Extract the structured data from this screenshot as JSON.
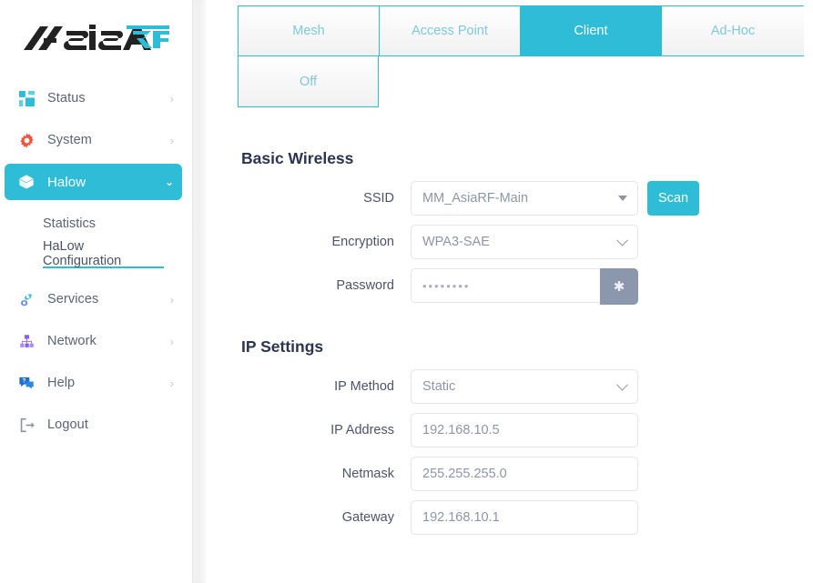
{
  "brand": {
    "name_dark": "Asia",
    "name_accent": "RF",
    "accent_color": "#2ebcd6",
    "dark_color": "#222222"
  },
  "sidebar": {
    "items": [
      {
        "label": "Status",
        "icon": "grid-icon",
        "caret": "›",
        "active": false
      },
      {
        "label": "System",
        "icon": "gear-icon",
        "caret": "›",
        "active": false
      },
      {
        "label": "Halow",
        "icon": "cube-icon",
        "caret": "⌄",
        "active": true
      },
      {
        "label": "Services",
        "icon": "gears-icon",
        "caret": "›",
        "active": false
      },
      {
        "label": "Network",
        "icon": "sitemap-icon",
        "caret": "›",
        "active": false
      },
      {
        "label": "Help",
        "icon": "help-chat-icon",
        "caret": "›",
        "active": false
      },
      {
        "label": "Logout",
        "icon": "logout-icon",
        "caret": "",
        "active": false
      }
    ],
    "subitems": [
      {
        "label": "Statistics",
        "current": false
      },
      {
        "label": "HaLow Configuration",
        "current": true
      }
    ]
  },
  "main": {
    "tabs": [
      {
        "label": "Mesh",
        "active": false
      },
      {
        "label": "Access Point",
        "active": false
      },
      {
        "label": "Client",
        "active": true
      },
      {
        "label": "Ad-Hoc",
        "active": false
      },
      {
        "label": "Off",
        "active": false
      }
    ],
    "basic_wireless": {
      "title": "Basic Wireless",
      "ssid": {
        "label": "SSID",
        "value": "MM_AsiaRF-Main",
        "options": [
          "MM_AsiaRF-Main"
        ],
        "scan_label": "Scan"
      },
      "encryption": {
        "label": "Encryption",
        "value": "WPA3-SAE",
        "options": [
          "WPA3-SAE"
        ]
      },
      "password": {
        "label": "Password",
        "value": "••••••••",
        "toggle_glyph": "✱"
      }
    },
    "ip_settings": {
      "title": "IP Settings",
      "ip_method": {
        "label": "IP Method",
        "value": "Static",
        "options": [
          "Static"
        ]
      },
      "ip_address": {
        "label": "IP Address",
        "value": "192.168.10.5"
      },
      "netmask": {
        "label": "Netmask",
        "value": "255.255.255.0"
      },
      "gateway": {
        "label": "Gateway",
        "value": "192.168.10.1"
      }
    }
  }
}
